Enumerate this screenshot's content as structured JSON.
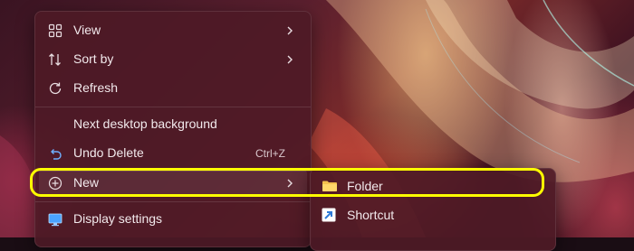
{
  "context_menu": {
    "items": [
      {
        "label": "View",
        "icon": "grid-view-icon",
        "has_submenu": true
      },
      {
        "label": "Sort by",
        "icon": "sort-icon",
        "has_submenu": true
      },
      {
        "label": "Refresh",
        "icon": "refresh-icon",
        "has_submenu": false
      },
      {
        "label": "Next desktop background",
        "icon": "",
        "has_submenu": false
      },
      {
        "label": "Undo Delete",
        "icon": "undo-icon",
        "shortcut": "Ctrl+Z",
        "has_submenu": false
      },
      {
        "label": "New",
        "icon": "add-circle-icon",
        "has_submenu": true,
        "active": true
      },
      {
        "label": "Display settings",
        "icon": "display-settings-icon",
        "has_submenu": false
      }
    ]
  },
  "submenu_new": {
    "items": [
      {
        "label": "Folder",
        "icon": "folder-icon"
      },
      {
        "label": "Shortcut",
        "icon": "shortcut-icon"
      }
    ]
  },
  "colors": {
    "highlight": "#ffff00",
    "folder": "#f4c04e",
    "shortcut": "#2f7ad8"
  }
}
